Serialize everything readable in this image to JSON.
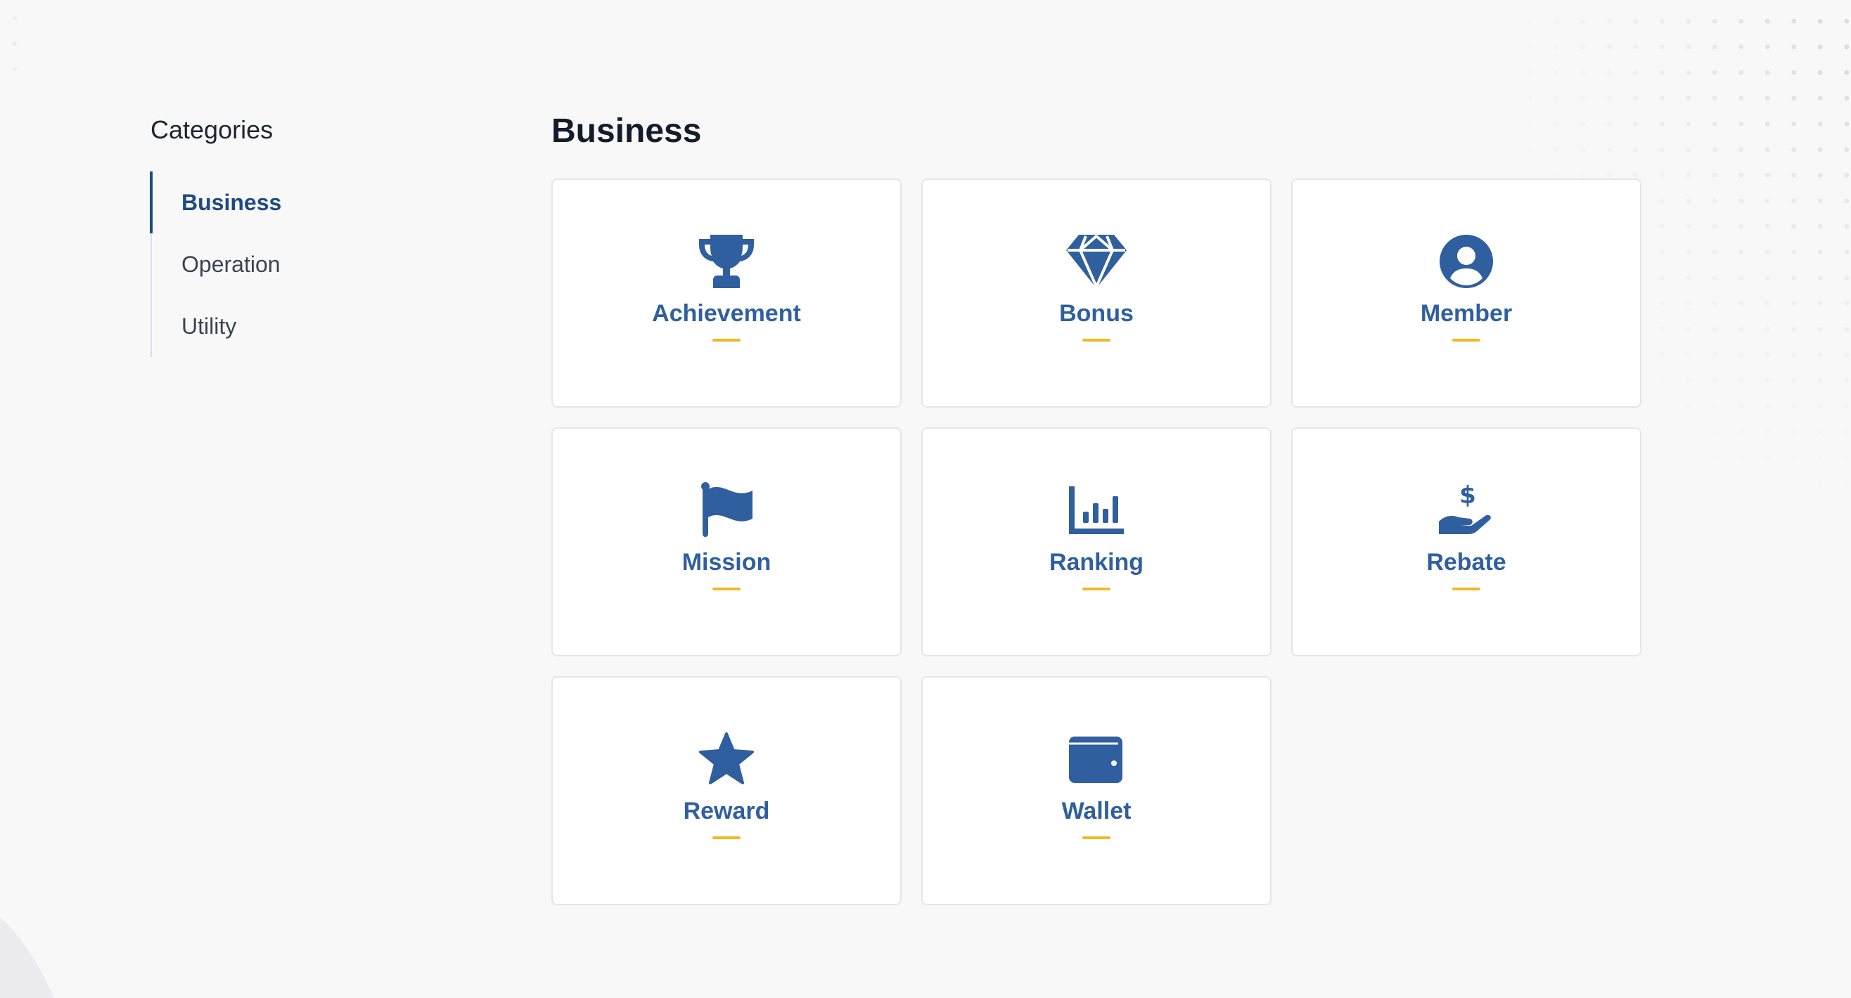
{
  "sidebar": {
    "title": "Categories",
    "items": [
      {
        "label": "Business",
        "active": true
      },
      {
        "label": "Operation",
        "active": false
      },
      {
        "label": "Utility",
        "active": false
      }
    ]
  },
  "main": {
    "title": "Business",
    "cards": [
      {
        "label": "Achievement",
        "icon": "trophy-icon"
      },
      {
        "label": "Bonus",
        "icon": "diamond-icon"
      },
      {
        "label": "Member",
        "icon": "user-circle-icon"
      },
      {
        "label": "Mission",
        "icon": "flag-icon"
      },
      {
        "label": "Ranking",
        "icon": "bar-chart-icon"
      },
      {
        "label": "Rebate",
        "icon": "hand-dollar-icon"
      },
      {
        "label": "Reward",
        "icon": "star-icon"
      },
      {
        "label": "Wallet",
        "icon": "wallet-icon"
      }
    ]
  },
  "colors": {
    "accent": "#2f5f9e",
    "active_nav": "#1c4b82",
    "underline": "#f3b922",
    "background": "#f8f8f9"
  }
}
